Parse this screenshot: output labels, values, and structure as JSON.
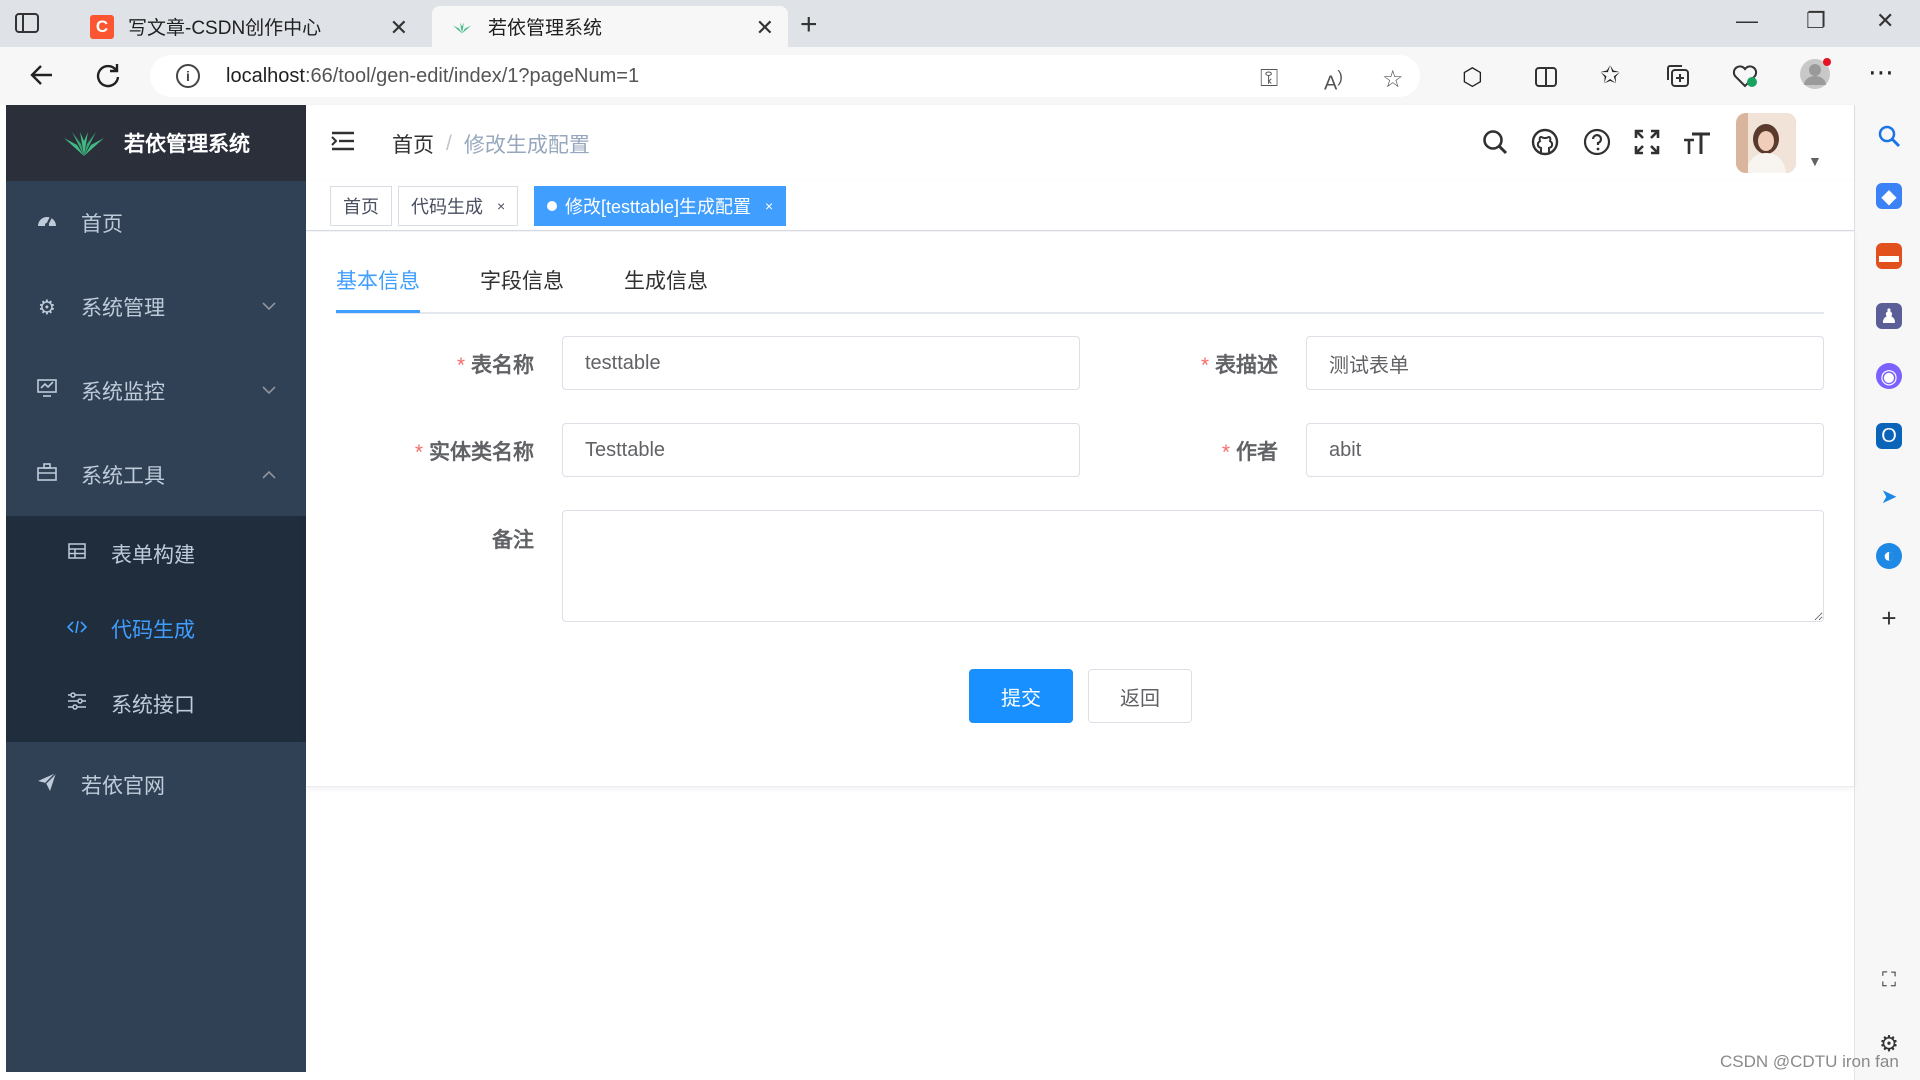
{
  "browser": {
    "tabs": [
      {
        "title": "写文章-CSDN创作中心",
        "favicon": "C",
        "active": false
      },
      {
        "title": "若依管理系统",
        "active": true
      }
    ],
    "url_host": "localhost",
    "url_rest": ":66/tool/gen-edit/index/1?pageNum=1"
  },
  "app": {
    "title": "若依管理系统"
  },
  "sidebar": {
    "items": [
      {
        "label": "首页",
        "icon": "dashboard-icon"
      },
      {
        "label": "系统管理",
        "icon": "gear-icon",
        "expanded": false
      },
      {
        "label": "系统监控",
        "icon": "monitor-icon",
        "expanded": false
      },
      {
        "label": "系统工具",
        "icon": "toolbox-icon",
        "expanded": true
      },
      {
        "label": "若依官网",
        "icon": "send-icon"
      }
    ],
    "subitems": [
      {
        "label": "表单构建",
        "icon": "table-icon",
        "active": false
      },
      {
        "label": "代码生成",
        "icon": "code-icon",
        "active": true
      },
      {
        "label": "系统接口",
        "icon": "sliders-icon",
        "active": false
      }
    ]
  },
  "navbar": {
    "breadcrumb_home": "首页",
    "breadcrumb_sep": "/",
    "breadcrumb_current": "修改生成配置"
  },
  "tagsview": {
    "tags": [
      {
        "label": "首页",
        "closable": false,
        "active": false
      },
      {
        "label": "代码生成",
        "closable": true,
        "active": false
      },
      {
        "label": "修改[testtable]生成配置",
        "closable": true,
        "active": true
      }
    ],
    "close_glyph": "×"
  },
  "form_tabs": [
    {
      "label": "基本信息",
      "active": true
    },
    {
      "label": "字段信息",
      "active": false
    },
    {
      "label": "生成信息",
      "active": false
    }
  ],
  "form": {
    "required_mark": "*",
    "table_name_label": "表名称",
    "table_name_value": "testtable",
    "table_desc_label": "表描述",
    "table_desc_value": "测试表单",
    "class_name_label": "实体类名称",
    "class_name_value": "Testtable",
    "author_label": "作者",
    "author_value": "abit",
    "remark_label": "备注",
    "remark_value": "",
    "submit_label": "提交",
    "back_label": "返回"
  },
  "watermark": "CSDN @CDTU iron fan",
  "colors": {
    "sidebar_bg": "#304156",
    "submenu_bg": "#1f2d3d",
    "primary": "#409eff",
    "button_primary": "#1890ff",
    "required": "#f56c6c"
  }
}
